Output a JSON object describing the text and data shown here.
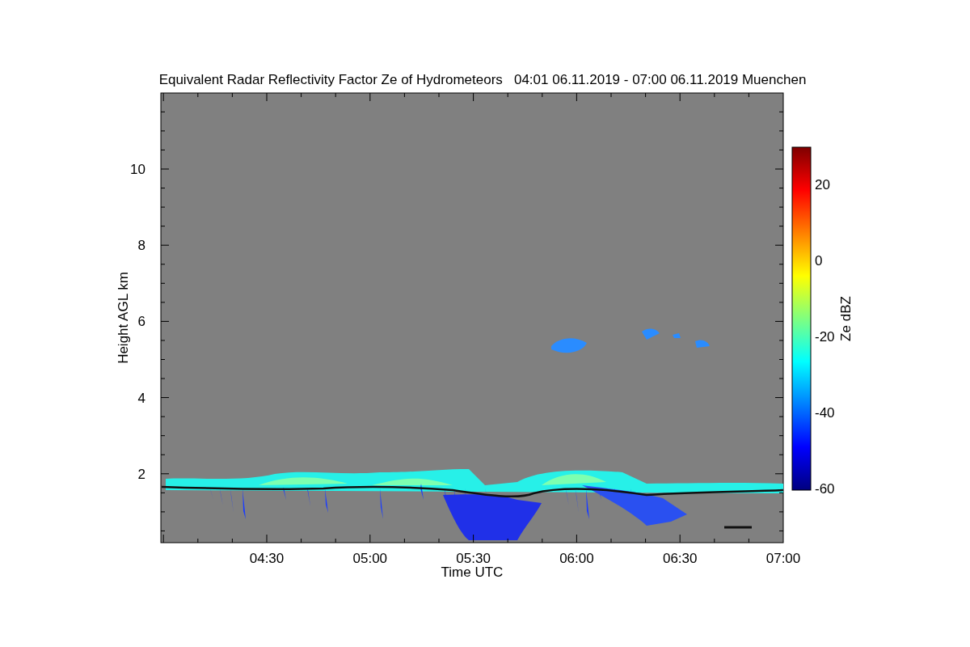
{
  "title": "Equivalent Radar Reflectivity Factor Ze of Hydrometeors   04:01 06.11.2019 - 07:00 06.11.2019 Muenchen",
  "yaxis": {
    "label": "Height AGL km",
    "ticks": [
      "10",
      "8",
      "6",
      "4",
      "2"
    ]
  },
  "xaxis": {
    "label": "Time UTC",
    "ticks": [
      "04:30",
      "05:00",
      "05:30",
      "06:00",
      "06:30",
      "07:00"
    ]
  },
  "colorbar": {
    "label": "Ze dBZ",
    "ticks": [
      "20",
      "0",
      "-20",
      "-40",
      "-60"
    ]
  }
}
